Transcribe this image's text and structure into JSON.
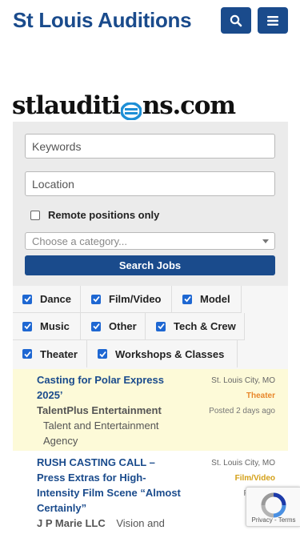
{
  "header": {
    "title": "St Louis Auditions",
    "search_icon": "search-icon",
    "menu_icon": "menu-icon",
    "brand_color": "#1a4b8c"
  },
  "logo": {
    "text_before": "stlauditi",
    "text_after": "ns.com"
  },
  "search_form": {
    "keywords_placeholder": "Keywords",
    "location_placeholder": "Location",
    "remote_label": "Remote positions only",
    "remote_checked": false,
    "category_placeholder": "Choose a category...",
    "submit_label": "Search Jobs"
  },
  "filters": [
    {
      "label": "Dance",
      "checked": true
    },
    {
      "label": "Film/Video",
      "checked": true
    },
    {
      "label": "Model",
      "checked": true
    },
    {
      "label": "Music",
      "checked": true
    },
    {
      "label": "Other",
      "checked": true
    },
    {
      "label": "Tech & Crew",
      "checked": true
    },
    {
      "label": "Theater",
      "checked": true
    },
    {
      "label": "Workshops & Classes",
      "checked": true
    }
  ],
  "jobs": [
    {
      "title_lines": [
        "Casting for Polar Express",
        "2025’"
      ],
      "company": "TalentPlus Entertainment",
      "tagline": "Talent and Entertainment Agency",
      "location": "St. Louis City, MO",
      "type": "Theater",
      "type_color": "#e8872b",
      "posted": "Posted 2 days ago",
      "highlighted": true
    },
    {
      "title_lines": [
        "RUSH CASTING CALL –",
        "Press Extras for High-",
        "Intensity Film Scene “Almost",
        "Certainly”"
      ],
      "company": "J P Marie LLC",
      "tagline": "Vision and",
      "location": "St. Louis City, MO",
      "type": "Film/Video",
      "type_color": "#d4a017",
      "posted": "Posted 1",
      "highlighted": false
    }
  ],
  "recaptcha": {
    "footer": "Privacy - Terms"
  }
}
